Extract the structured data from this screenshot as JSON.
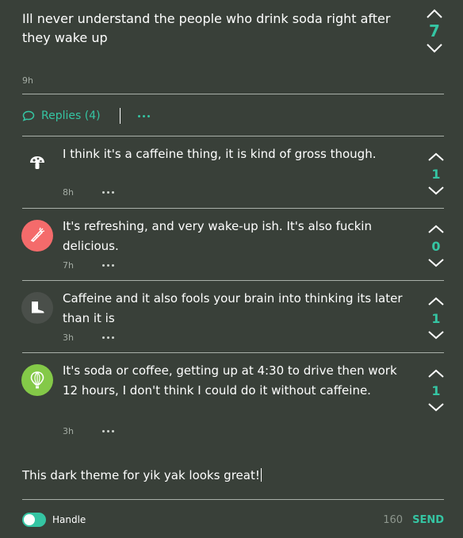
{
  "colors": {
    "background": "#394039",
    "accent": "#35c5a3",
    "muted": "#a4aca4"
  },
  "post": {
    "text": "Ill never understand the people who drink soda right after they wake up",
    "time": "9h",
    "votes": "7",
    "upvote_icon": "chevron-up-icon",
    "downvote_icon": "chevron-down-icon"
  },
  "replies_bar": {
    "label": "Replies (4)",
    "icon": "speech-bubble-icon"
  },
  "comments": [
    {
      "text": "I think it's a caffeine thing, it is kind of gross though.",
      "time": "8h",
      "votes": "1",
      "avatar_icon": "mushroom-icon",
      "avatar_color": "#4a4f4a"
    },
    {
      "text": "It's refreshing, and very wake-up ish.  It's also fuckin delicious.",
      "time": "7h",
      "votes": "0",
      "avatar_icon": "carrot-icon",
      "avatar_color": "#f46b6b"
    },
    {
      "text": "Caffeine and it also fools your brain into thinking its later than it is",
      "time": "3h",
      "votes": "1",
      "avatar_icon": "boot-icon",
      "avatar_color": "#4a4f4a"
    },
    {
      "text": "It's soda or coffee, getting up at 4:30 to drive then work 12 hours, I don't think I could do it without caffeine.",
      "time": "3h",
      "votes": "1",
      "avatar_icon": "hot-air-balloon-icon",
      "avatar_color": "#84c948"
    }
  ],
  "composer": {
    "value": "This dark theme for yik yak looks great!"
  },
  "footer": {
    "handle_label": "Handle",
    "char_count": "160",
    "send_label": "SEND"
  }
}
